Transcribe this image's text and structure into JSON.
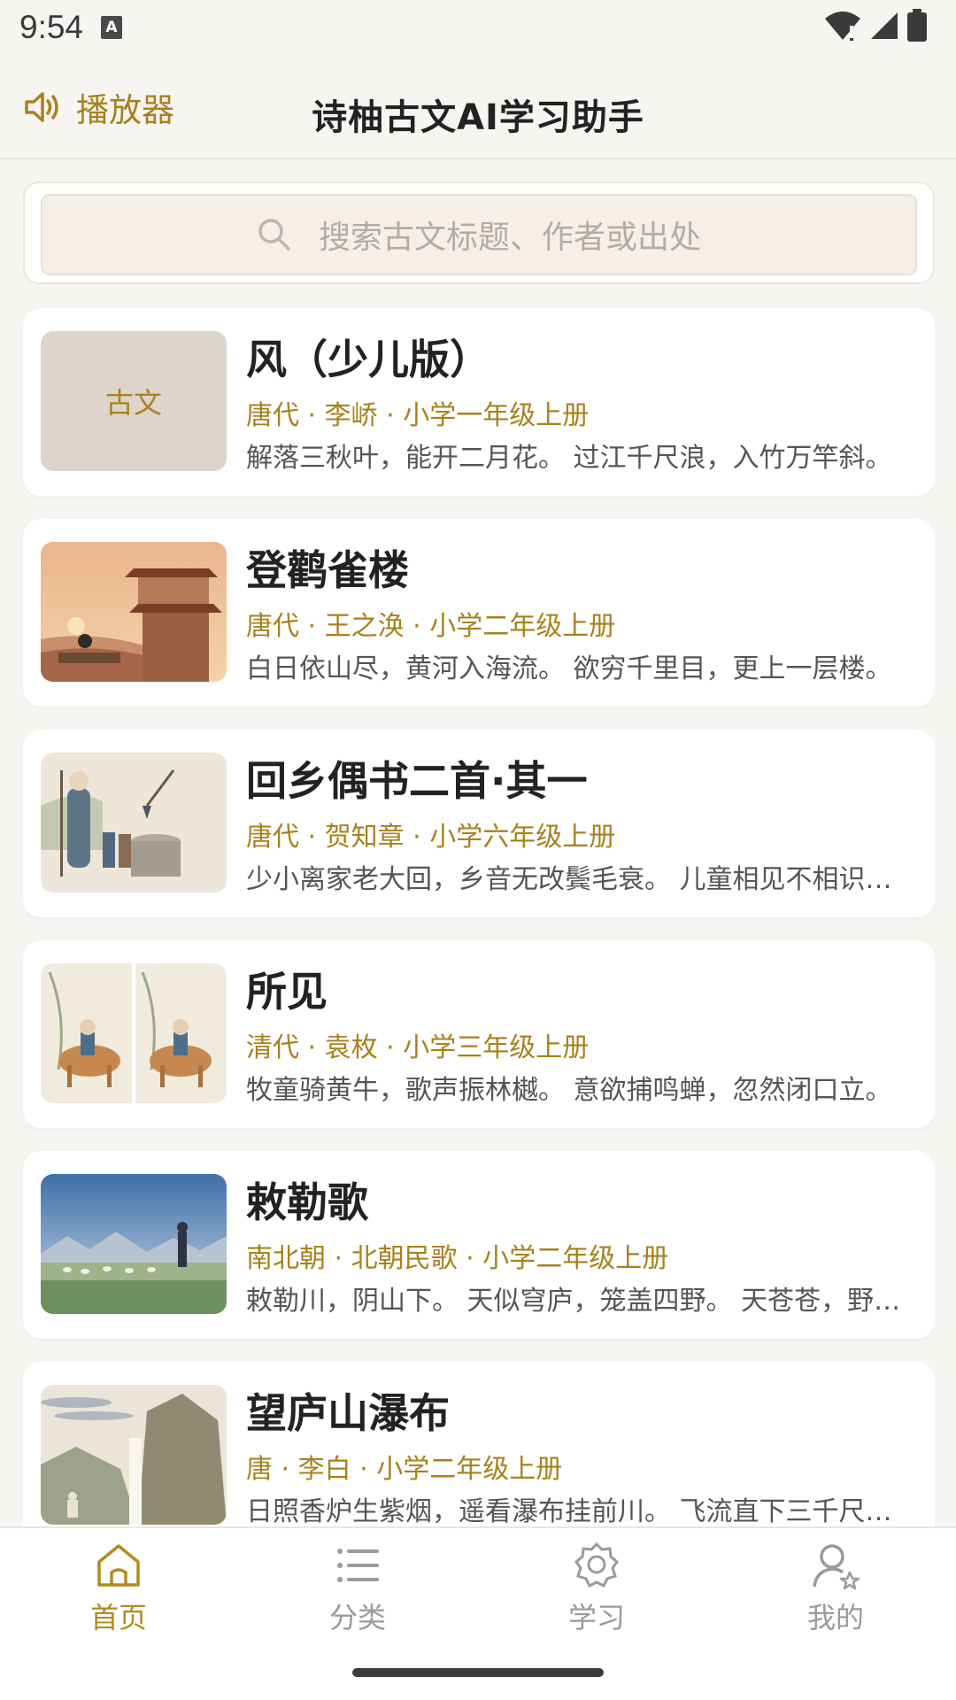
{
  "status_bar": {
    "time": "9:54",
    "badge": "A"
  },
  "header": {
    "player_label": "播放器",
    "title": "诗柚古文AI学习助手"
  },
  "search": {
    "placeholder": "搜索古文标题、作者或出处"
  },
  "cards": [
    {
      "title": "风（少儿版）",
      "meta": "唐代 · 李峤 · 小学一年级上册",
      "excerpt": "解落三秋叶，能开二月花。 过江千尺浪，入竹万竿斜。",
      "thumb_label": "古文"
    },
    {
      "title": "登鹳雀楼",
      "meta": "唐代 · 王之涣 · 小学二年级上册",
      "excerpt": "白日依山尽，黄河入海流。 欲穷千里目，更上一层楼。"
    },
    {
      "title": "回乡偶书二首·其一",
      "meta": "唐代 · 贺知章 · 小学六年级上册",
      "excerpt": "少小离家老大回，乡音无改鬓毛衰。 儿童相见不相识，笑问客从何处来。"
    },
    {
      "title": "所见",
      "meta": "清代 · 袁枚 · 小学三年级上册",
      "excerpt": "牧童骑黄牛，歌声振林樾。 意欲捕鸣蝉，忽然闭口立。"
    },
    {
      "title": "敕勒歌",
      "meta": "南北朝 · 北朝民歌 · 小学二年级上册",
      "excerpt": "敕勒川，阴山下。 天似穹庐，笼盖四野。 天苍苍，野茫茫，风吹草低见牛羊。"
    },
    {
      "title": "望庐山瀑布",
      "meta": "唐 · 李白 · 小学二年级上册",
      "excerpt": "日照香炉生紫烟，遥看瀑布挂前川。 飞流直下三千尺，疑是银河落九天。"
    }
  ],
  "tabs": [
    {
      "label": "首页",
      "icon": "home-icon",
      "active": true
    },
    {
      "label": "分类",
      "icon": "list-icon",
      "active": false
    },
    {
      "label": "学习",
      "icon": "badge-icon",
      "active": false
    },
    {
      "label": "我的",
      "icon": "user-star-icon",
      "active": false
    }
  ],
  "colors": {
    "accent": "#a8811c",
    "background": "#f7f5f2"
  }
}
